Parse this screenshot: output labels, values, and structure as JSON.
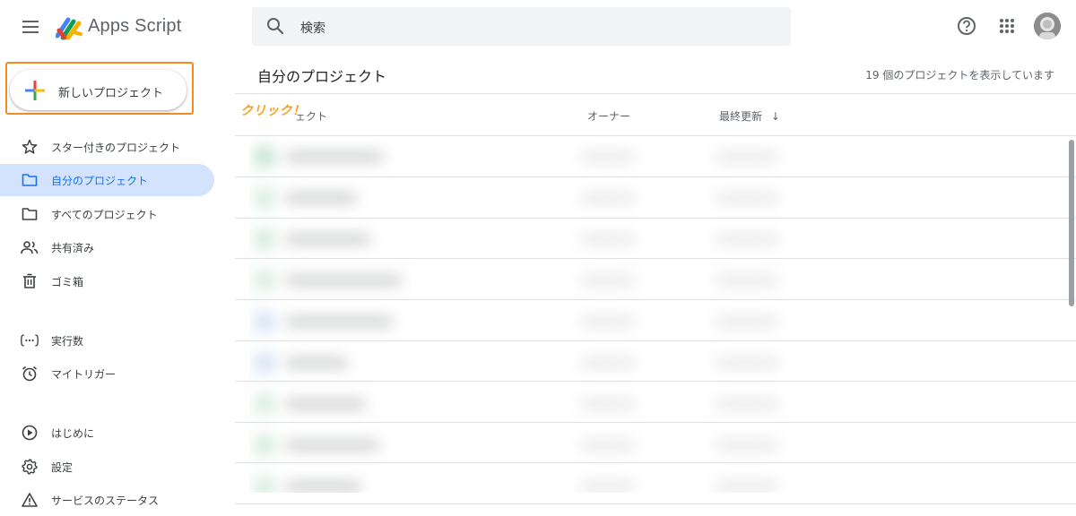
{
  "app": {
    "title": "Apps Script"
  },
  "search": {
    "placeholder": "検索"
  },
  "header_icons": [
    "menu-icon",
    "help-icon",
    "apps-grid-icon",
    "account-avatar"
  ],
  "sidebar": {
    "new_project_label": "新しいプロジェクト",
    "items": [
      {
        "label": "スター付きのプロジェクト",
        "icon": "star-icon",
        "active": false
      },
      {
        "label": "自分のプロジェクト",
        "icon": "folder-icon",
        "active": true
      },
      {
        "label": "すべてのプロジェクト",
        "icon": "folder-icon",
        "active": false
      },
      {
        "label": "共有済み",
        "icon": "people-icon",
        "active": false
      },
      {
        "label": "ゴミ箱",
        "icon": "trash-icon",
        "active": false
      },
      {
        "label": "実行数",
        "icon": "executions-icon",
        "active": false
      },
      {
        "label": "マイトリガー",
        "icon": "alarm-icon",
        "active": false
      },
      {
        "label": "はじめに",
        "icon": "play-circle-icon",
        "active": false
      },
      {
        "label": "設定",
        "icon": "gear-icon",
        "active": false
      },
      {
        "label": "サービスのステータス",
        "icon": "warning-icon",
        "active": false
      }
    ]
  },
  "main": {
    "title": "自分のプロジェクト",
    "count_text": "19 個のプロジェクトを表示しています",
    "columns": {
      "name": "ェクト",
      "owner": "オーナー",
      "modified": "最終更新",
      "sort_arrow": "↓"
    },
    "annotation": "クリック！"
  },
  "colors": {
    "accent": "#1a73e8",
    "active_bg": "#d3e3fd",
    "highlight_border": "#f28b22",
    "annotation": "#f7a21b"
  }
}
